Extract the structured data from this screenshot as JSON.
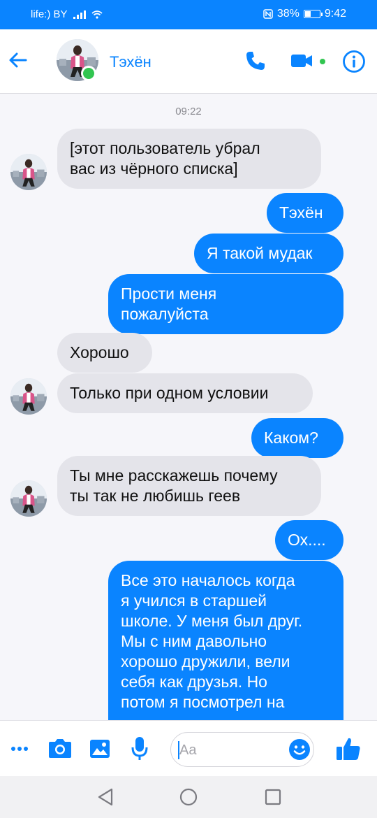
{
  "status_bar": {
    "carrier": "life:) BY",
    "battery_text": "38%",
    "battery_level": 0.38,
    "time": "9:42"
  },
  "header": {
    "contact_name": "Тэхён",
    "online": true
  },
  "chat": {
    "timestamp": "09:22",
    "messages": [
      {
        "side": "in",
        "text": "[этот пользователь убрал\nвас из чёрного списка]"
      },
      {
        "side": "out",
        "text": "Тэхён"
      },
      {
        "side": "out",
        "text": "Я такой мудак"
      },
      {
        "side": "out",
        "text": "Прости меня\nпожалуйста"
      },
      {
        "side": "in",
        "text": "Хорошо"
      },
      {
        "side": "in",
        "text": "Только при одном условии"
      },
      {
        "side": "out",
        "text": "Каком?"
      },
      {
        "side": "in",
        "text": "Ты мне расскажешь почему\nты так не любишь геев"
      },
      {
        "side": "out",
        "text": "Ох...."
      },
      {
        "side": "out",
        "text": "Все это началось когда\nя учился в старшей\nшколе. У меня был друг.\nМы с ним давольно\nхорошо дружили, вели\nсебя как друзья. Но\nпотом я посмотрел на"
      }
    ]
  },
  "composer": {
    "placeholder": "Aa"
  },
  "colors": {
    "accent": "#0a84ff",
    "incoming_bubble": "#e4e4ea",
    "online": "#31c550",
    "chat_background": "#f6f6fa"
  },
  "icons": {
    "back": "arrow-left-icon",
    "call": "phone-icon",
    "video": "video-camera-icon",
    "info": "info-icon",
    "more": "more-dots-icon",
    "camera": "camera-icon",
    "gallery": "image-icon",
    "mic": "microphone-icon",
    "emoji": "smiley-icon",
    "like": "thumbs-up-icon",
    "nav_back": "triangle-back-icon",
    "nav_home": "circle-home-icon",
    "nav_recents": "square-recents-icon"
  }
}
